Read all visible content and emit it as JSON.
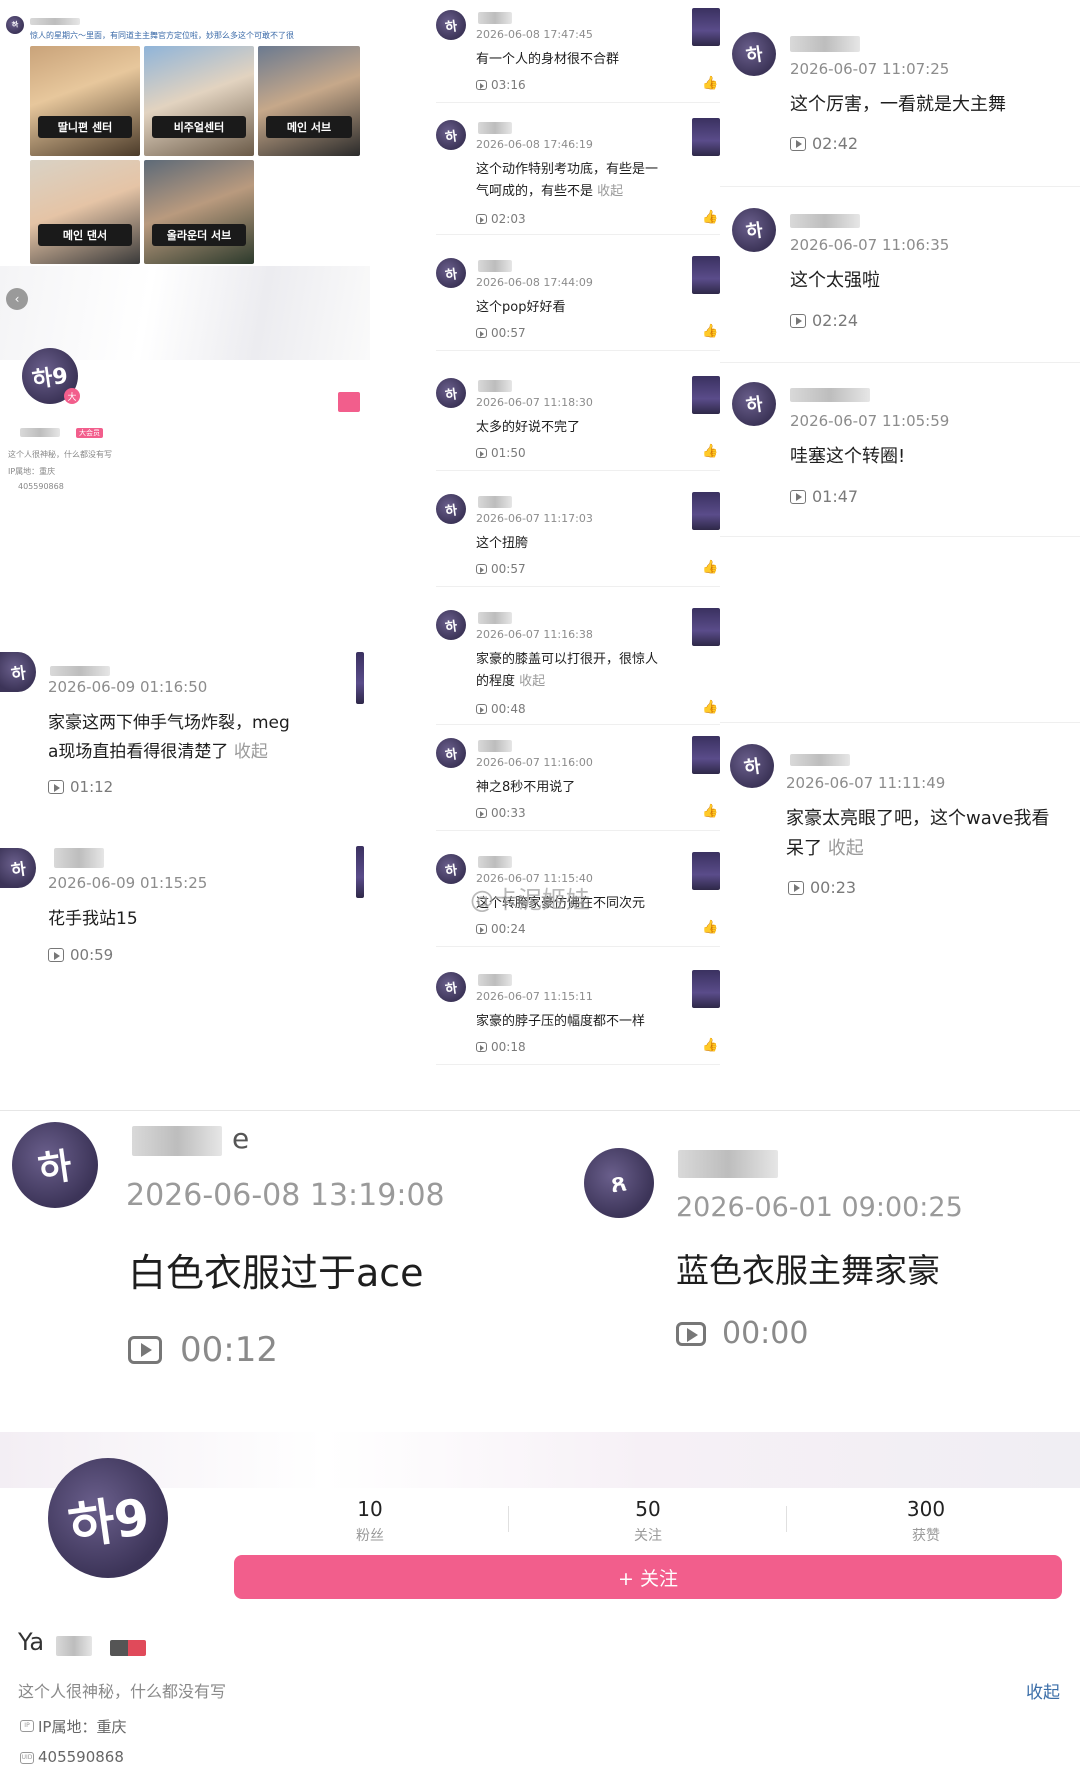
{
  "topleft_post": {
    "caption": "惊人的星期六～里面，有同道主主舞官方定位啦，妙那么多这个可敢不了很",
    "photo_tags": [
      "딸니편 센터",
      "비주얼센터",
      "메인 서브",
      "메인 댄서",
      "올라운더 서브"
    ]
  },
  "topleft_profile": {
    "badge": "大",
    "tag": "大会员",
    "bio": "这个人很神秘，什么都没有写",
    "ip": "IP属地：重庆",
    "uid": "405590868"
  },
  "left_comments": [
    {
      "time": "2026-06-09 01:16:50",
      "text": "家豪这两下伸手气场炸裂，meg",
      "text2": "a现场直拍看得很清楚了",
      "fold": "收起",
      "duration": "01:12"
    },
    {
      "time": "2026-06-09 01:15:25",
      "text": "花手我站15",
      "duration": "00:59"
    }
  ],
  "middle_comments": [
    {
      "time": "2026-06-08 17:47:45",
      "text": "有一个人的身材很不合群",
      "duration": "03:16"
    },
    {
      "time": "2026-06-08 17:46:19",
      "text": "这个动作特别考功底，有些是一",
      "text2": "气呵成的，有些不是",
      "fold": "收起",
      "duration": "02:03"
    },
    {
      "time": "2026-06-08 17:44:09",
      "text": "这个pop好好看",
      "duration": "00:57"
    },
    {
      "time": "2026-06-07 11:18:30",
      "text": "太多的好说不完了",
      "duration": "01:50"
    },
    {
      "time": "2026-06-07 11:17:03",
      "text": "这个扭胯",
      "duration": "00:57"
    },
    {
      "time": "2026-06-07 11:16:38",
      "text": "家豪的膝盖可以打很开，很惊人",
      "text2": "的程度",
      "fold": "收起",
      "duration": "00:48"
    },
    {
      "time": "2026-06-07 11:16:00",
      "text": "神之8秒不用说了",
      "duration": "00:33"
    },
    {
      "time": "2026-06-07 11:15:40",
      "text": "这个转胯家豪仿佛在不同次元",
      "duration": "00:24"
    },
    {
      "time": "2026-06-07 11:15:11",
      "text": "家豪的脖子压的幅度都不一样",
      "duration": "00:18"
    }
  ],
  "right_comments": [
    {
      "time": "2026-06-07 11:07:25",
      "text": "这个厉害，一看就是大主舞",
      "duration": "02:42"
    },
    {
      "time": "2026-06-07 11:06:35",
      "text": "这个太强啦",
      "duration": "02:24"
    },
    {
      "time": "2026-06-07 11:05:59",
      "text": "哇塞这个转圈!",
      "duration": "01:47"
    },
    {
      "time": "2026-06-07 11:11:49",
      "text": "家豪太亮眼了吧，这个wave我看",
      "text2": "呆了",
      "fold": "收起",
      "duration": "00:23"
    }
  ],
  "watermark": "@卡泥姬娃",
  "bottom_comments": [
    {
      "username_end": "e",
      "time": "2026-06-08 13:19:08",
      "text": "白色衣服过于ace",
      "duration": "00:12"
    },
    {
      "time": "2026-06-01 09:00:25",
      "text": "蓝色衣服主舞家豪",
      "duration": "00:00"
    }
  ],
  "profile": {
    "avatar_text": "하9",
    "name_prefix": "Ya",
    "fans": "10",
    "fans_label": "粉丝",
    "following": "50",
    "following_label": "关注",
    "likes": "300",
    "likes_label": "获赞",
    "follow_button": "+ 关注",
    "bio": "这个人很神秘，什么都没有写",
    "collapse": "收起",
    "ip": "IP属地：重庆",
    "uid": "405590868"
  },
  "colors": {
    "accent": "#f25e8c",
    "link": "#3b6ea8"
  }
}
